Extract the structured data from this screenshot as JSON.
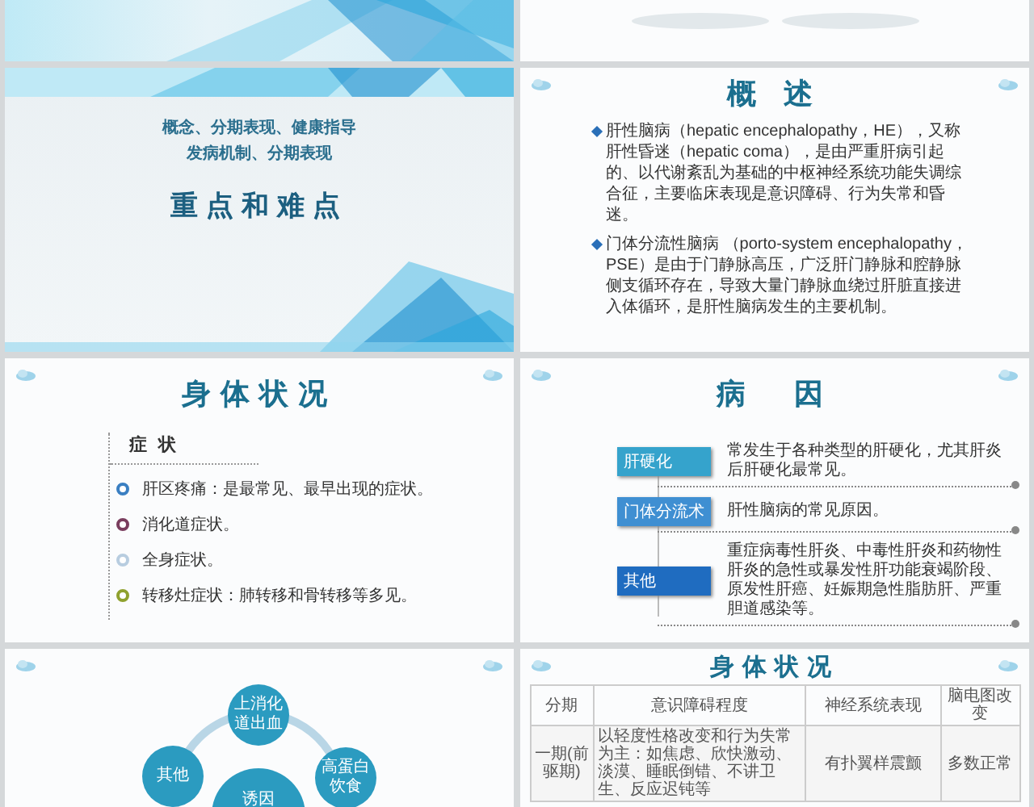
{
  "slides": [
    {
      "kind": "cover-edge"
    },
    {
      "kind": "blank"
    },
    {
      "kind": "cover",
      "subtitles": [
        "概念、分期表现、健康指导",
        "发病机制、分期表现"
      ],
      "title": "重点和难点"
    },
    {
      "kind": "overview",
      "title": "概 述",
      "paragraphs": [
        "肝性脑病（hepatic encephalopathy，HE），又称肝性昏迷（hepatic coma），是由严重肝病引起的、以代谢紊乱为基础的中枢神经系统功能失调综合征，主要临床表现是意识障碍、行为失常和昏迷。",
        "门体分流性脑病 （porto-system encephalopathy，PSE）是由于门静脉高压，广泛肝门静脉和腔静脉侧支循环存在，导致大量门静脉血绕过肝脏直接进入体循环，是肝性脑病发生的主要机制。"
      ]
    },
    {
      "kind": "symptoms",
      "title": "身体状况",
      "heading": "症 状",
      "items": [
        {
          "text": "肝区疼痛：是最常见、最早出现的症状。",
          "color": "#3a7fc2"
        },
        {
          "text": "消化道症状。",
          "color": "#7a3d5e"
        },
        {
          "text": "全身症状。",
          "color": "#b8cde0"
        },
        {
          "text": "转移灶症状：肺转移和骨转移等多见。",
          "color": "#8fa12e"
        }
      ]
    },
    {
      "kind": "causes",
      "title": "病　因",
      "rows": [
        {
          "label": "肝硬化",
          "text": "常发生于各种类型的肝硬化，尤其肝炎后肝硬化最常见。",
          "color": "#35a3cc"
        },
        {
          "label": "门体分流术",
          "text": "肝性脑病的常见原因。",
          "color": "#3f8fd2"
        },
        {
          "label": "其他",
          "text": "重症病毒性肝炎、中毒性肝炎和药物性肝炎的急性或暴发性肝功能衰竭阶段、原发性肝癌、妊娠期急性脂肪肝、严重胆道感染等。",
          "color": "#1f6cc0"
        }
      ]
    },
    {
      "kind": "cycle",
      "nodes": [
        "上消化道出血",
        "其他",
        "高蛋白饮食"
      ],
      "center": "诱因"
    },
    {
      "kind": "table",
      "title": "身体状况",
      "columns": [
        "分期",
        "意识障碍程度",
        "神经系统表现",
        "脑电图改变"
      ],
      "rows": [
        [
          "一期(前驱期)",
          "以轻度性格改变和行为失常为主：如焦虑、欣快激动、淡漠、睡眠倒错、不讲卫生、反应迟钝等",
          "有扑翼样震颤",
          "多数正常"
        ]
      ]
    }
  ]
}
